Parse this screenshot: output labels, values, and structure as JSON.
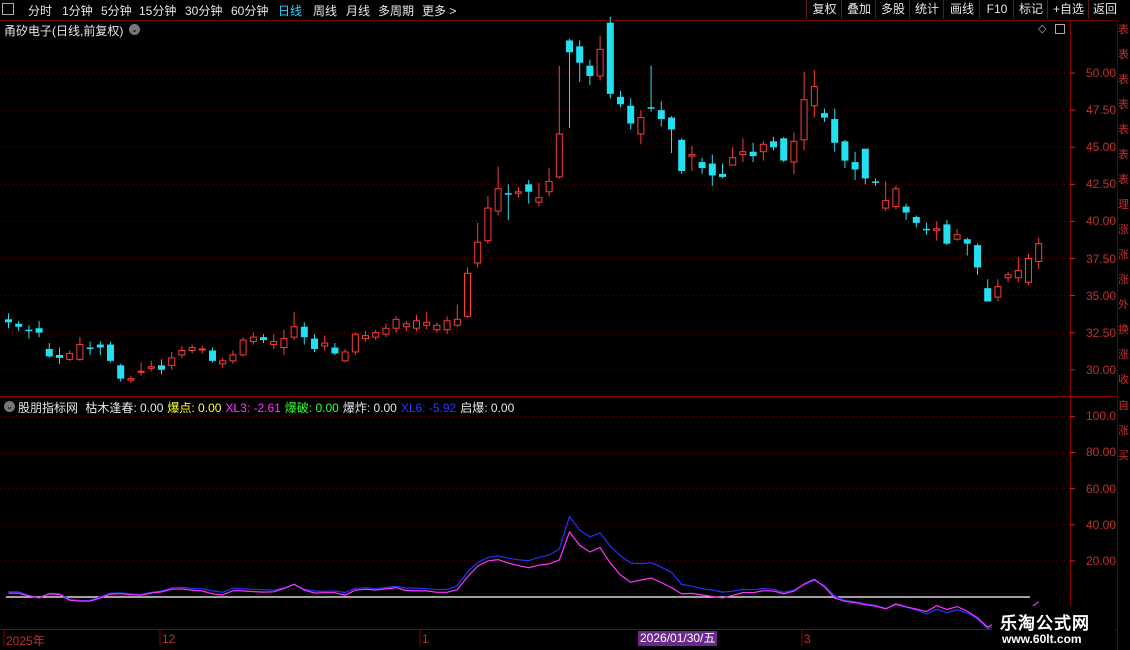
{
  "toolbar": {
    "timeframes": [
      "分时",
      "1分钟",
      "5分钟",
      "15分钟",
      "30分钟",
      "60分钟",
      "日线",
      "周线",
      "月线",
      "多周期",
      "更多 >"
    ],
    "active_timeframe": "日线",
    "right_buttons": [
      "复权",
      "叠加",
      "多股",
      "统计",
      "画线",
      "F10",
      "标记",
      "+自选",
      "返回"
    ]
  },
  "stock": {
    "title": "甬矽电子(日线,前复权)"
  },
  "indicator": {
    "name": "股朋指标网",
    "fields": [
      {
        "label": "枯木逢春:",
        "value": "0.00",
        "color": "#e6e6e6"
      },
      {
        "label": "爆点:",
        "value": "0.00",
        "color": "#ffff33"
      },
      {
        "label": "XL3:",
        "value": "-2.61",
        "color": "#ff33ff"
      },
      {
        "label": "爆破:",
        "value": "0.00",
        "color": "#33ff33"
      },
      {
        "label": "爆炸:",
        "value": "0.00",
        "color": "#e6e6e6"
      },
      {
        "label": "XL6:",
        "value": "-5.92",
        "color": "#3333ff"
      },
      {
        "label": "启爆:",
        "value": "0.00",
        "color": "#e6e6e6"
      }
    ]
  },
  "price_axis": [
    "50.00",
    "47.50",
    "45.00",
    "42.50",
    "40.00",
    "37.50",
    "35.00",
    "32.50",
    "30.00"
  ],
  "indicator_axis": [
    "100.0",
    "80.00",
    "60.00",
    "40.00",
    "20.00"
  ],
  "date_axis": [
    {
      "label": "2025年",
      "x": 6
    },
    {
      "label": "12",
      "x": 162
    },
    {
      "label": "1",
      "x": 422
    },
    {
      "label": "3",
      "x": 804
    }
  ],
  "highlight_date": "2026/01/30/五",
  "right_strip_text": "表表表表表表表理涨涨涨外换涨收",
  "right_strip_text2": "自涨买",
  "watermark": {
    "line1": "乐淘公式网",
    "line2": "www.60lt.com"
  },
  "colors": {
    "up": "#ff3b3b",
    "down": "#22e0f0",
    "grid": "#6b0000",
    "xl3": "#ff33ff",
    "xl6": "#2233ff"
  },
  "chart_data": {
    "type": "candlestick",
    "ylim": [
      28.5,
      52.5
    ],
    "candles": [
      [
        33.4,
        33.2,
        33.8,
        32.8
      ],
      [
        33.1,
        32.9,
        33.3,
        32.6
      ],
      [
        32.7,
        32.6,
        33.0,
        32.1
      ],
      [
        32.8,
        32.5,
        33.3,
        32.2
      ],
      [
        31.4,
        30.9,
        31.8,
        30.8
      ],
      [
        31.0,
        30.8,
        31.5,
        30.4
      ],
      [
        30.7,
        31.1,
        31.3,
        30.6
      ],
      [
        30.7,
        31.7,
        32.2,
        30.6
      ],
      [
        31.5,
        31.4,
        31.9,
        31.0
      ],
      [
        31.7,
        31.5,
        31.9,
        31.0
      ],
      [
        31.7,
        30.6,
        31.9,
        30.5
      ],
      [
        30.3,
        29.4,
        30.4,
        29.2
      ],
      [
        29.3,
        29.4,
        29.6,
        29.1
      ],
      [
        29.9,
        29.9,
        30.5,
        29.6
      ],
      [
        30.1,
        30.2,
        30.6,
        29.9
      ],
      [
        30.3,
        30.0,
        30.7,
        29.7
      ],
      [
        30.3,
        30.8,
        31.2,
        30.0
      ],
      [
        31.0,
        31.3,
        31.6,
        30.8
      ],
      [
        31.3,
        31.5,
        31.7,
        31.1
      ],
      [
        31.4,
        31.4,
        31.6,
        31.1
      ],
      [
        31.3,
        30.6,
        31.5,
        30.5
      ],
      [
        30.4,
        30.6,
        30.8,
        30.1
      ],
      [
        30.6,
        31.0,
        31.3,
        30.4
      ],
      [
        31.0,
        32.0,
        32.2,
        30.9
      ],
      [
        31.9,
        32.2,
        32.5,
        31.7
      ],
      [
        32.2,
        32.0,
        32.4,
        31.8
      ],
      [
        31.7,
        31.9,
        32.4,
        31.4
      ],
      [
        31.5,
        32.1,
        32.7,
        31.0
      ],
      [
        32.2,
        32.9,
        33.9,
        32.0
      ],
      [
        32.9,
        32.2,
        33.2,
        31.7
      ],
      [
        32.1,
        31.4,
        32.4,
        31.2
      ],
      [
        31.6,
        31.8,
        32.3,
        31.3
      ],
      [
        31.5,
        31.1,
        31.8,
        31.0
      ],
      [
        30.6,
        31.2,
        31.4,
        30.5
      ],
      [
        31.2,
        32.4,
        32.5,
        31.0
      ],
      [
        32.1,
        32.3,
        32.6,
        31.9
      ],
      [
        32.2,
        32.5,
        32.7,
        32.0
      ],
      [
        32.4,
        32.8,
        33.1,
        32.2
      ],
      [
        32.8,
        33.4,
        33.6,
        32.5
      ],
      [
        32.9,
        33.1,
        33.3,
        32.6
      ],
      [
        32.8,
        33.3,
        33.7,
        32.6
      ],
      [
        33.0,
        33.2,
        33.9,
        32.7
      ],
      [
        32.7,
        33.0,
        33.2,
        32.5
      ],
      [
        32.7,
        33.3,
        33.6,
        32.4
      ],
      [
        33.0,
        33.4,
        34.4,
        32.9
      ],
      [
        33.6,
        36.5,
        36.9,
        33.5
      ],
      [
        37.2,
        38.6,
        39.9,
        36.9
      ],
      [
        38.7,
        40.9,
        41.7,
        38.5
      ],
      [
        40.7,
        42.2,
        43.7,
        40.4
      ],
      [
        41.9,
        41.8,
        42.5,
        40.1
      ],
      [
        41.9,
        42.0,
        42.3,
        41.6
      ],
      [
        42.5,
        42.0,
        42.8,
        41.2
      ],
      [
        41.3,
        41.6,
        42.6,
        41.0
      ],
      [
        42.0,
        42.7,
        43.6,
        41.7
      ],
      [
        43.0,
        45.9,
        50.5,
        42.9
      ],
      [
        52.2,
        51.4,
        52.3,
        46.3
      ],
      [
        51.8,
        50.7,
        52.2,
        49.4
      ],
      [
        50.5,
        49.8,
        50.9,
        49.2
      ],
      [
        49.8,
        51.6,
        52.5,
        49.5
      ],
      [
        53.4,
        48.6,
        53.8,
        48.3
      ],
      [
        48.4,
        47.9,
        48.8,
        47.7
      ],
      [
        47.8,
        46.6,
        48.3,
        46.2
      ],
      [
        45.9,
        47.0,
        47.5,
        45.2
      ],
      [
        47.7,
        47.6,
        50.5,
        47.4
      ],
      [
        47.5,
        46.9,
        48.1,
        46.4
      ],
      [
        47.0,
        46.2,
        47.1,
        44.6
      ],
      [
        45.5,
        43.4,
        45.6,
        43.2
      ],
      [
        44.4,
        44.5,
        45.1,
        43.4
      ],
      [
        44.0,
        43.6,
        44.3,
        43.2
      ],
      [
        43.9,
        43.1,
        44.5,
        42.4
      ],
      [
        43.2,
        43.0,
        43.9,
        42.9
      ],
      [
        43.8,
        44.3,
        45.0,
        43.9
      ],
      [
        44.5,
        44.7,
        45.6,
        44.0
      ],
      [
        44.7,
        44.4,
        45.3,
        44.0
      ],
      [
        44.7,
        45.2,
        45.4,
        44.1
      ],
      [
        45.4,
        45.0,
        45.7,
        44.8
      ],
      [
        45.6,
        44.1,
        45.7,
        44.0
      ],
      [
        44.0,
        45.4,
        46.0,
        43.2
      ],
      [
        45.5,
        48.2,
        50.1,
        44.8
      ],
      [
        47.8,
        49.1,
        50.2,
        47.0
      ],
      [
        47.3,
        47.0,
        47.6,
        46.7
      ],
      [
        46.9,
        45.3,
        47.6,
        44.7
      ],
      [
        45.4,
        44.1,
        45.5,
        43.6
      ],
      [
        44.0,
        43.5,
        44.7,
        42.8
      ],
      [
        44.9,
        42.9,
        44.9,
        42.5
      ],
      [
        42.7,
        42.6,
        42.9,
        42.4
      ],
      [
        40.9,
        41.4,
        42.7,
        40.7
      ],
      [
        41.0,
        42.2,
        42.4,
        40.8
      ],
      [
        41.0,
        40.6,
        41.2,
        40.1
      ],
      [
        40.3,
        39.9,
        40.4,
        39.6
      ],
      [
        39.5,
        39.4,
        39.9,
        39.1
      ],
      [
        39.4,
        39.5,
        40.0,
        38.7
      ],
      [
        39.8,
        38.5,
        40.1,
        38.4
      ],
      [
        38.8,
        39.1,
        39.5,
        38.7
      ],
      [
        38.8,
        38.5,
        38.9,
        37.7
      ],
      [
        38.4,
        36.9,
        38.5,
        36.4
      ],
      [
        35.5,
        34.6,
        36.1,
        34.6
      ],
      [
        34.9,
        35.6,
        36.1,
        34.6
      ],
      [
        36.2,
        36.4,
        36.6,
        35.9
      ],
      [
        36.2,
        36.7,
        37.6,
        35.9
      ],
      [
        35.9,
        37.5,
        37.8,
        35.7
      ],
      [
        37.3,
        38.5,
        38.9,
        36.8
      ]
    ],
    "xl6": [
      2.8,
      2.8,
      0.8,
      -0.6,
      2.0,
      1.8,
      -1.3,
      -2.0,
      -1.8,
      0.1,
      2.1,
      2.2,
      1.7,
      1.5,
      2.6,
      3.3,
      5.1,
      5.4,
      4.8,
      4.6,
      3.4,
      2.6,
      4.9,
      4.6,
      4.2,
      4.1,
      3.8,
      4.9,
      6.8,
      4.3,
      3.3,
      3.1,
      3.3,
      2.5,
      4.8,
      5.1,
      4.6,
      5.2,
      5.9,
      5.0,
      4.9,
      4.6,
      4.1,
      4.2,
      6.1,
      13.9,
      19.1,
      21.9,
      22.8,
      21.5,
      20.6,
      20.1,
      22.0,
      23.2,
      26.6,
      44.5,
      37.0,
      33.3,
      35.4,
      28.2,
      22.8,
      18.8,
      18.5,
      19.0,
      16.5,
      13.6,
      7.0,
      6.0,
      4.6,
      3.8,
      2.7,
      3.2,
      4.2,
      4.0,
      4.7,
      4.3,
      2.6,
      3.8,
      6.8,
      9.2,
      6.3,
      0.5,
      -1.8,
      -2.7,
      -3.8,
      -4.6,
      -6.3,
      -4.3,
      -5.6,
      -7.2,
      -9.4,
      -6.8,
      -8.7,
      -7.1,
      -8.9,
      -12.1,
      -17.4,
      -15.8,
      -12.9,
      -12.4,
      -10.2,
      -5.9
    ],
    "xl3": [
      2.1,
      2.1,
      0.5,
      -0.4,
      1.7,
      1.4,
      -1.8,
      -2.2,
      -2.3,
      -0.6,
      1.6,
      1.8,
      1.3,
      1.0,
      2.2,
      2.8,
      4.3,
      4.5,
      3.8,
      3.4,
      1.7,
      1.2,
      3.5,
      3.4,
      3.0,
      2.7,
      2.9,
      4.7,
      7.1,
      3.8,
      2.2,
      2.4,
      2.4,
      1.0,
      3.8,
      4.3,
      3.9,
      4.5,
      5.2,
      3.6,
      3.4,
      3.4,
      2.6,
      2.6,
      4.1,
      11.1,
      17.1,
      20.0,
      20.7,
      18.8,
      17.4,
      16.2,
      17.6,
      18.3,
      20.5,
      36.0,
      28.6,
      24.9,
      27.4,
      18.7,
      12.2,
      8.2,
      9.4,
      10.5,
      8.0,
      5.2,
      1.7,
      2.0,
      1.1,
      0.3,
      -0.5,
      0.9,
      2.5,
      2.4,
      3.5,
      3.3,
      1.8,
      3.2,
      7.2,
      9.8,
      5.6,
      -0.6,
      -2.4,
      -3.1,
      -4.3,
      -5.0,
      -6.6,
      -3.8,
      -5.4,
      -6.7,
      -8.1,
      -4.8,
      -6.9,
      -5.3,
      -7.8,
      -11.5,
      -16.7,
      -13.6,
      -11.2,
      -10.0,
      -6.8,
      -2.6
    ]
  }
}
